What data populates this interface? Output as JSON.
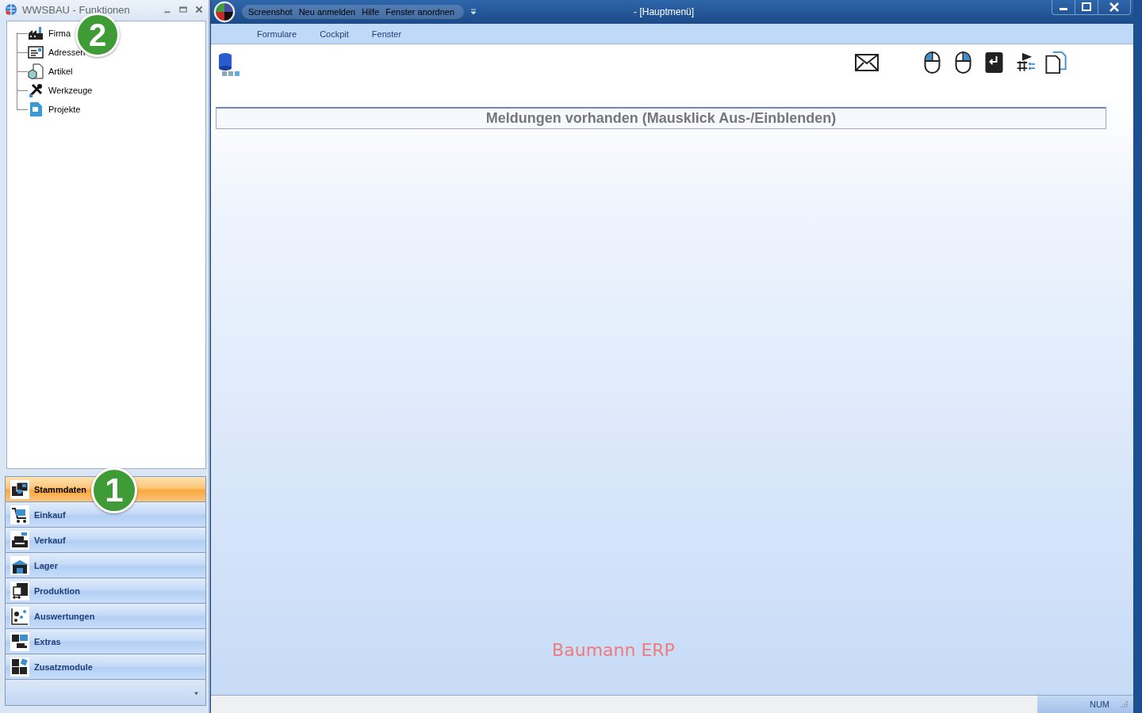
{
  "left_window": {
    "title": "WWSBAU - Funktionen",
    "tree": [
      {
        "label": "Firma"
      },
      {
        "label": "Adressen"
      },
      {
        "label": "Artikel"
      },
      {
        "label": "Werkzeuge"
      },
      {
        "label": "Projekte"
      }
    ],
    "nav": [
      {
        "label": "Stammdaten",
        "selected": true
      },
      {
        "label": "Einkauf",
        "selected": false
      },
      {
        "label": "Verkauf",
        "selected": false
      },
      {
        "label": "Lager",
        "selected": false
      },
      {
        "label": "Produktion",
        "selected": false
      },
      {
        "label": "Auswertungen",
        "selected": false
      },
      {
        "label": "Extras",
        "selected": false
      },
      {
        "label": "Zusatzmodule",
        "selected": false
      }
    ]
  },
  "callouts": [
    {
      "label": "2"
    },
    {
      "label": "1"
    }
  ],
  "main_window": {
    "quick_access": [
      "Screenshot",
      "Neu anmelden",
      "Hilfe",
      "Fenster anordnen"
    ],
    "title": "- [Hauptmenü]",
    "menu": [
      "Formulare",
      "Cockpit",
      "Fenster"
    ],
    "message_bar": "Meldungen vorhanden  (Mausklick Aus-/Einblenden)",
    "brand": "Baumann ERP",
    "status_bar": {
      "num": "NUM"
    }
  }
}
